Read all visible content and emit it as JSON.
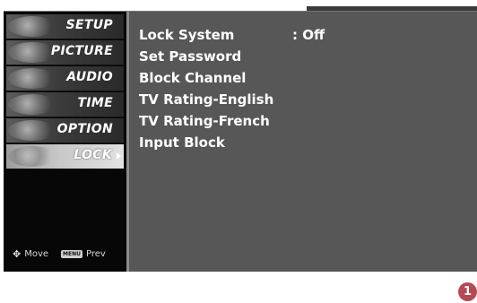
{
  "sidebar": {
    "items": [
      {
        "label": "SETUP"
      },
      {
        "label": "PICTURE"
      },
      {
        "label": "AUDIO"
      },
      {
        "label": "TIME"
      },
      {
        "label": "OPTION"
      },
      {
        "label": "LOCK"
      }
    ],
    "active_index": 5,
    "hint": {
      "move_label": "Move",
      "menu_key": "MENU",
      "prev_label": "Prev"
    }
  },
  "lock_menu": {
    "items": [
      {
        "label": "Lock System",
        "value": ": Off"
      },
      {
        "label": "Set Password"
      },
      {
        "label": "Block Channel"
      },
      {
        "label": "TV Rating-English"
      },
      {
        "label": "TV Rating-French"
      },
      {
        "label": "Input Block"
      }
    ]
  },
  "step_badge": "1",
  "colors": {
    "badge": "#b64a54",
    "panel": "#575757",
    "sidebar": "#070707"
  }
}
